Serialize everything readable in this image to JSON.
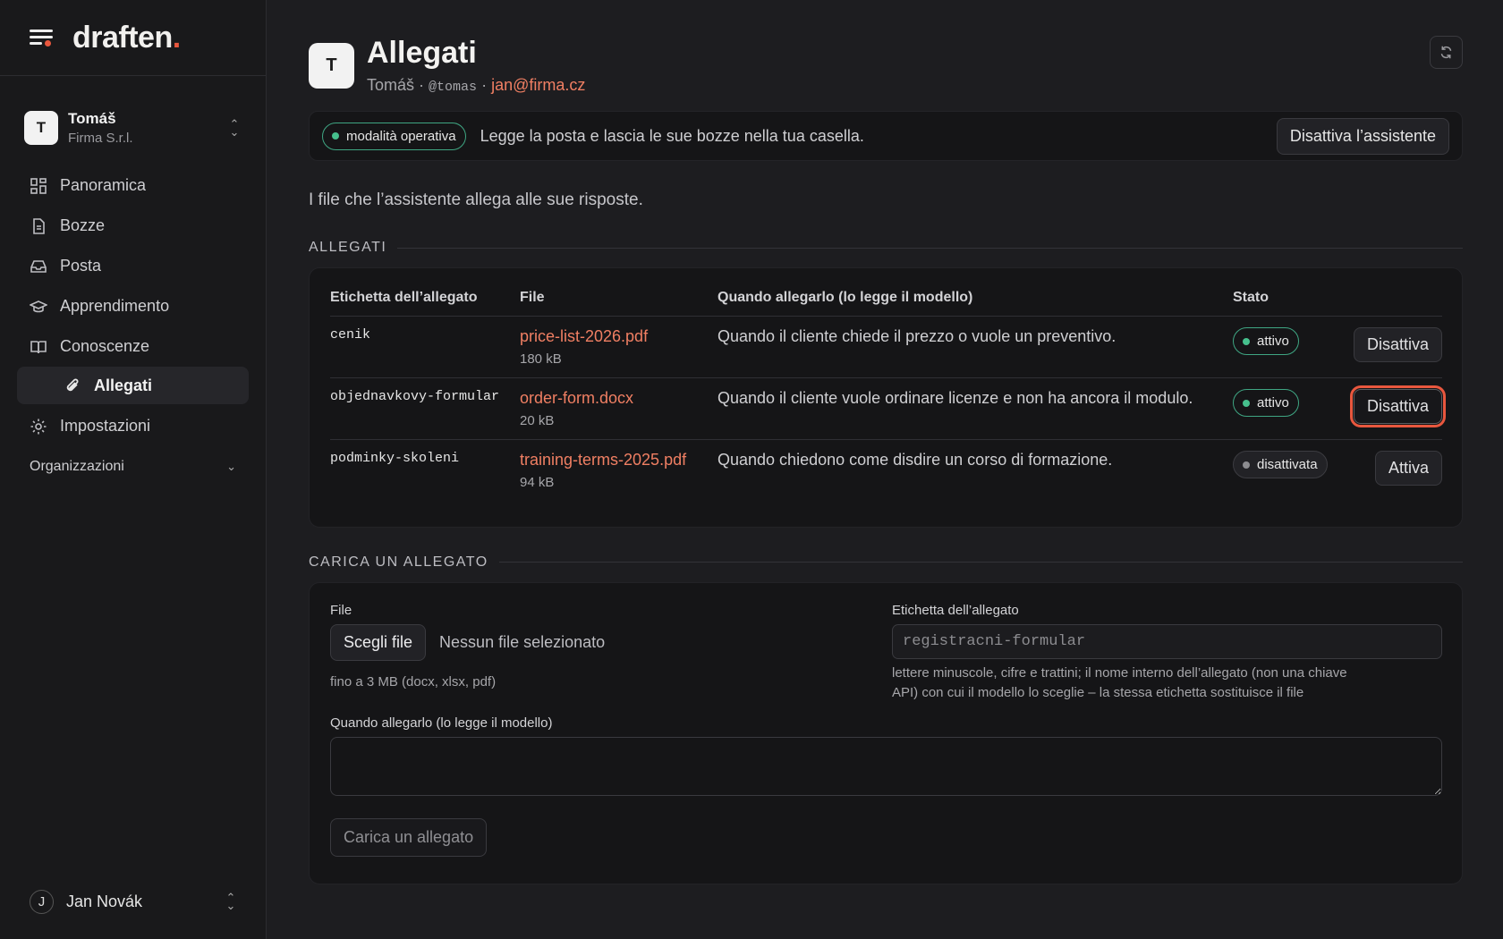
{
  "brand": {
    "name": "draften",
    "dot": "."
  },
  "org": {
    "initial": "T",
    "name": "Tomáš",
    "company": "Firma S.r.l."
  },
  "nav": {
    "items": [
      {
        "label": "Panoramica"
      },
      {
        "label": "Bozze"
      },
      {
        "label": "Posta"
      },
      {
        "label": "Apprendimento"
      },
      {
        "label": "Conoscenze"
      },
      {
        "label": "Allegati"
      },
      {
        "label": "Impostazioni"
      }
    ],
    "section": "Organizzazioni"
  },
  "user": {
    "initial": "J",
    "name": "Jan Novák"
  },
  "header": {
    "initial": "T",
    "title": "Allegati",
    "name": "Tomáš",
    "sep": "·",
    "handle": "@tomas",
    "email": "jan@firma.cz"
  },
  "banner": {
    "mode": "modalità operativa",
    "text": "Legge la posta e lascia le sue bozze nella tua casella.",
    "button": "Disattiva l’assistente"
  },
  "intro": "I file che l’assistente allega alle sue risposte.",
  "attachments": {
    "section": "ALLEGATI",
    "columns": [
      "Etichetta dell’allegato",
      "File",
      "Quando allegarlo (lo legge il modello)",
      "Stato"
    ],
    "rows": [
      {
        "label": "cenik",
        "file": "price-list-2026.pdf",
        "size": "180 kB",
        "when": "Quando il cliente chiede il prezzo o vuole un preventivo.",
        "status": "attivo",
        "action": "Disattiva"
      },
      {
        "label": "objednavkovy-formular",
        "file": "order-form.docx",
        "size": "20 kB",
        "when": "Quando il cliente vuole ordinare licenze e non ha ancora il modulo.",
        "status": "attivo",
        "action": "Disattiva"
      },
      {
        "label": "podminky-skoleni",
        "file": "training-terms-2025.pdf",
        "size": "94 kB",
        "when": "Quando chiedono come disdire un corso di formazione.",
        "status": "disattivata",
        "action": "Attiva"
      }
    ]
  },
  "upload": {
    "section": "CARICA UN ALLEGATO",
    "file_label": "File",
    "choose": "Scegli file",
    "no_file": "Nessun file selezionato",
    "file_hint": "fino a 3 MB (docx, xlsx, pdf)",
    "tag_label": "Etichetta dell’allegato",
    "tag_placeholder": "registracni-formular",
    "tag_hint": "lettere minuscole, cifre e trattini; il nome interno dell’allegato (non una chiave API) con cui il modello lo sceglie – la stessa etichetta sostituisce il file",
    "when_label": "Quando allegarlo (lo legge il modello)",
    "when_value": "",
    "submit": "Carica un allegato"
  },
  "colors": {
    "accent": "#e8573e",
    "link": "#f07f63",
    "active": "#46c08d"
  }
}
